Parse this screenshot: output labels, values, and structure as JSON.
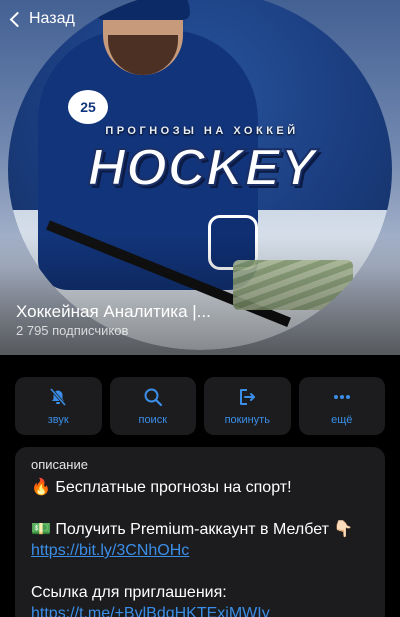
{
  "nav": {
    "back_label": "Назад"
  },
  "hero": {
    "tagline": "ПРОГНОЗЫ НА ХОККЕЙ",
    "brand_title": "HOCKEY",
    "badge_number": "25",
    "channel_name": "Хоккейная Аналитика |...",
    "subscribers": "2 795 подписчиков"
  },
  "actions": [
    {
      "label": "звук",
      "icon": "bell-slash-icon"
    },
    {
      "label": "поиск",
      "icon": "search-icon"
    },
    {
      "label": "покинуть",
      "icon": "leave-icon"
    },
    {
      "label": "ещё",
      "icon": "more-icon"
    }
  ],
  "description": {
    "header": "описание",
    "line1_emoji": "🔥",
    "line1_text": "Бесплатные прогнозы на спорт!",
    "line2_emoji": "💵",
    "line2_text": "Получить Premium-аккаунт в Мелбет",
    "line2_emoji_after": "👇🏻",
    "link1": "https://bit.ly/3CNhOHc",
    "invite_label": "Ссылка для приглашения:",
    "link2": "https://t.me/+BvlBdqHKTExjMWIy"
  },
  "colors": {
    "accent": "#3a8ee8",
    "card": "#1c1c1e",
    "background": "#000000"
  }
}
